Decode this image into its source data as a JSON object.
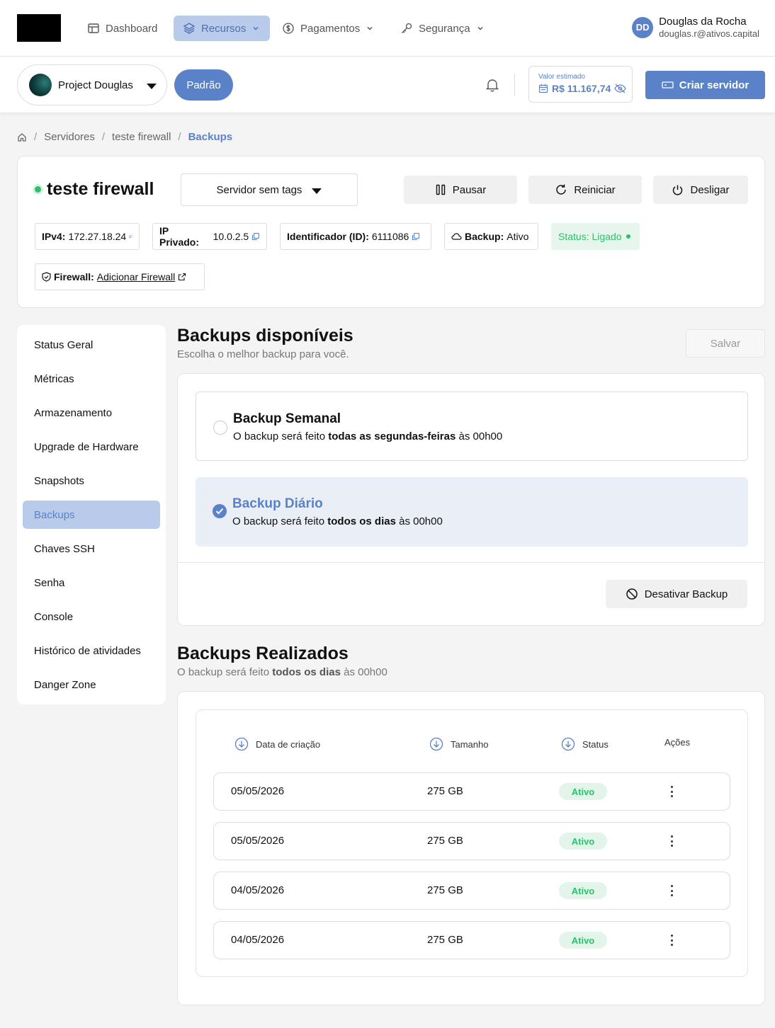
{
  "nav": {
    "items": [
      {
        "label": "Dashboard"
      },
      {
        "label": "Recursos"
      },
      {
        "label": "Pagamentos"
      },
      {
        "label": "Segurança"
      }
    ],
    "user": {
      "initials": "DD",
      "name": "Douglas da Rocha",
      "email": "douglas.r@ativos.capital"
    }
  },
  "subheader": {
    "project": "Project Douglas",
    "badge": "Padrão",
    "estimate_label": "Valor estimado",
    "estimate_value": "R$ 11.167,74",
    "create_label": "Criar servidor"
  },
  "breadcrumb": {
    "items": [
      "Servidores",
      "teste firewall",
      "Backups"
    ]
  },
  "server": {
    "name": "teste firewall",
    "tags_label": "Servidor sem tags",
    "actions": {
      "pause": "Pausar",
      "restart": "Reiniciar",
      "shutdown": "Desligar"
    },
    "info": {
      "ipv4_label": "IPv4:",
      "ipv4": "172.27.18.24",
      "private_label": "IP Privado:",
      "private": "10.0.2.5",
      "id_label": "Identificador (ID):",
      "id": "6111086",
      "backup_label": "Backup:",
      "backup": "Ativo",
      "status": "Status: Ligado",
      "firewall_label": "Firewall:",
      "firewall_link": "Adicionar Firewall"
    }
  },
  "sidemenu": {
    "items": [
      {
        "label": "Status Geral"
      },
      {
        "label": "Métricas"
      },
      {
        "label": "Armazenamento"
      },
      {
        "label": "Upgrade de Hardware"
      },
      {
        "label": "Snapshots"
      },
      {
        "label": "Backups"
      },
      {
        "label": "Chaves SSH"
      },
      {
        "label": "Senha"
      },
      {
        "label": "Console"
      },
      {
        "label": "Histórico de atividades"
      },
      {
        "label": "Danger Zone"
      }
    ],
    "active": "Backups"
  },
  "backups": {
    "title": "Backups disponíveis",
    "subtitle": "Escolha o melhor backup para você.",
    "save_label": "Salvar",
    "options": [
      {
        "title": "Backup Semanal",
        "desc_pre": "O backup será feito ",
        "desc_bold": "todas as segundas-feiras",
        "desc_post": " às 00h00",
        "selected": false
      },
      {
        "title": "Backup Diário",
        "desc_pre": "O backup será feito ",
        "desc_bold": "todos os dias",
        "desc_post": " às 00h00",
        "selected": true
      }
    ],
    "disable_label": "Desativar Backup"
  },
  "done": {
    "title": "Backups Realizados",
    "sub_pre": "O backup será feito ",
    "sub_bold": "todos os dias",
    "sub_post": " às 00h00",
    "headers": [
      "Data de criação",
      "Tamanho",
      "Status",
      "Ações"
    ],
    "rows": [
      {
        "date": "05/05/2026",
        "size": "275 GB",
        "status": "Ativo"
      },
      {
        "date": "05/05/2026",
        "size": "275 GB",
        "status": "Ativo"
      },
      {
        "date": "04/05/2026",
        "size": "275 GB",
        "status": "Ativo"
      },
      {
        "date": "04/05/2026",
        "size": "275 GB",
        "status": "Ativo"
      }
    ]
  },
  "colors": {
    "accent": "#5a82c8",
    "accent_light": "#b9cbea",
    "success": "#2fbf6b"
  }
}
